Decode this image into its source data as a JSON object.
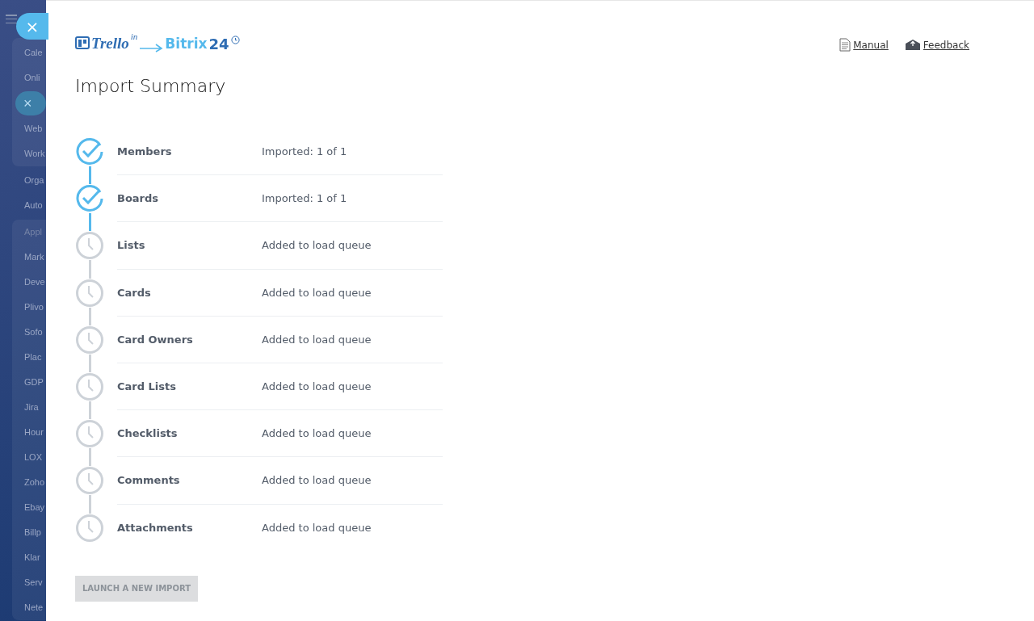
{
  "sidebar": {
    "groups": [
      {
        "boxed": true,
        "items": [
          {
            "label": "Cale",
            "kind": "item"
          },
          {
            "label": "Onli",
            "kind": "item"
          },
          {
            "label": "×",
            "kind": "chip"
          },
          {
            "label": "Web",
            "kind": "item"
          },
          {
            "label": "Work",
            "kind": "item"
          }
        ]
      },
      {
        "boxed": false,
        "items": [
          {
            "label": "Orga",
            "kind": "item"
          },
          {
            "label": "Auto",
            "kind": "item"
          }
        ]
      },
      {
        "boxed": true,
        "items": [
          {
            "label": "Appl",
            "kind": "header"
          },
          {
            "label": "Mark",
            "kind": "item"
          },
          {
            "label": "Deve",
            "kind": "item"
          },
          {
            "label": "Plivo",
            "kind": "item"
          },
          {
            "label": "Sofo",
            "kind": "item"
          },
          {
            "label": "Plac",
            "kind": "item"
          },
          {
            "label": "GDP",
            "kind": "item"
          },
          {
            "label": "Jira",
            "kind": "item"
          },
          {
            "label": "Hour",
            "kind": "item"
          },
          {
            "label": "LOX",
            "kind": "item"
          },
          {
            "label": "Zoho",
            "kind": "item"
          },
          {
            "label": "Ebay",
            "kind": "item"
          },
          {
            "label": "Billp",
            "kind": "item"
          },
          {
            "label": "Klar",
            "kind": "item"
          },
          {
            "label": "Serv",
            "kind": "item"
          },
          {
            "label": "Nete",
            "kind": "item"
          }
        ]
      }
    ]
  },
  "close_button": {
    "label": "×"
  },
  "logo": {
    "trello": "Trello",
    "in": "in",
    "bitrix": "Bitrix",
    "num": "24"
  },
  "links": [
    {
      "label": "Manual",
      "kind": "manual"
    },
    {
      "label": "Feedback",
      "kind": "feedback"
    }
  ],
  "title": "Import Summary",
  "steps": [
    {
      "name": "Members",
      "status": "Imported: 1 of 1",
      "kind": "done"
    },
    {
      "name": "Boards",
      "status": "Imported: 1 of 1",
      "kind": "done"
    },
    {
      "name": "Lists",
      "status": "Added to load queue",
      "kind": "pending"
    },
    {
      "name": "Cards",
      "status": "Added to load queue",
      "kind": "pending"
    },
    {
      "name": "Card Owners",
      "status": "Added to load queue",
      "kind": "pending"
    },
    {
      "name": "Card Lists",
      "status": "Added to load queue",
      "kind": "pending"
    },
    {
      "name": "Checklists",
      "status": "Added to load queue",
      "kind": "pending"
    },
    {
      "name": "Comments",
      "status": "Added to load queue",
      "kind": "pending"
    },
    {
      "name": "Attachments",
      "status": "Added to load queue",
      "kind": "pending"
    }
  ],
  "launch_button": {
    "label": "LAUNCH A NEW IMPORT",
    "disabled": true
  }
}
